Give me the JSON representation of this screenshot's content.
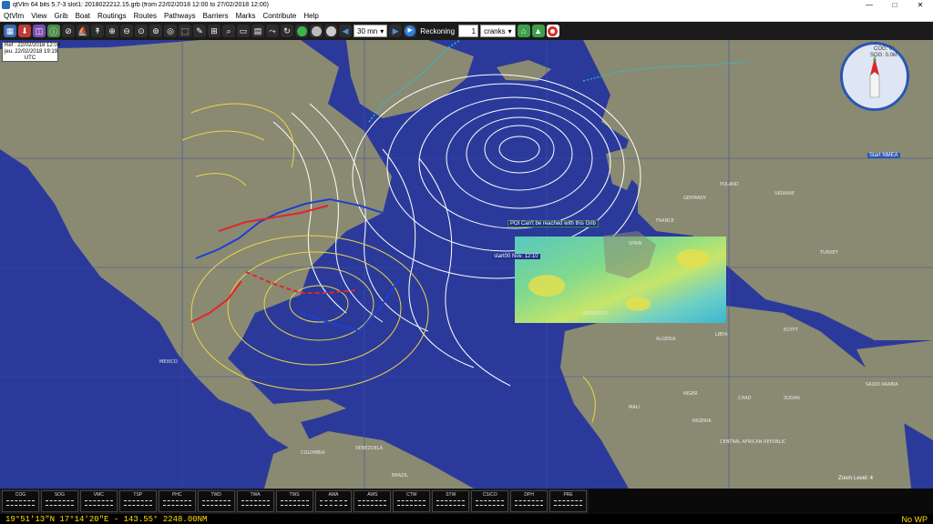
{
  "window": {
    "title": "qtVlm 64 bits 5.7-3 slot1: 2018022212.15.grb (from 22/02/2018 12:00 to 27/02/2018 12:00)",
    "minimize": "—",
    "maximize": "□",
    "close": "✕"
  },
  "menu": [
    "QtVlm",
    "View",
    "Grib",
    "Boat",
    "Routings",
    "Routes",
    "Pathways",
    "Barriers",
    "Marks",
    "Contribute",
    "Help"
  ],
  "toolbar": {
    "step": "30 mn",
    "mode": "Reckoning",
    "count": "1",
    "boat": "cranks"
  },
  "ref_box": {
    "ref": "Ref : 22/02/2018 12:00",
    "current": "jeu. 22/02/2018 19:19",
    "tz": "UTC"
  },
  "compass": {
    "cog": "COG: 0°",
    "sog": "SOG: 0.0kt",
    "start_nmea": "Start NMEA"
  },
  "map": {
    "grib_error": "POI Can't be reached with this Grib",
    "start_label": "start00 Nov. 12:10",
    "zoom": "Zoom Level: 4",
    "countries": [
      "MOROCCO",
      "ALGERIA",
      "LIBYA",
      "EGYPT",
      "MALI",
      "NIGER",
      "CHAD",
      "SUDAN",
      "NIGERIA",
      "CENTRAL AFRICAN REPUBLIC",
      "MEXICO",
      "VENEZUELA",
      "COLOMBIA",
      "BRAZIL",
      "SPAIN",
      "FRANCE",
      "GERMANY",
      "POLAND",
      "UKRAINE",
      "TURKEY",
      "SAUDI ARABIA"
    ]
  },
  "instruments": [
    "COG",
    "SOG",
    "VMC",
    "TSP",
    "PHC",
    "TWD",
    "TWA",
    "TWS",
    "AWA",
    "AWS",
    "CTW",
    "STW",
    "CS/CO",
    "DPH",
    "PRE"
  ],
  "status": {
    "position": "19°51'13\"N   17°14'20\"E - 143.55° 2248.00NM",
    "waypoint": "No WP"
  },
  "colors": {
    "ocean": "#2b3a9a",
    "land": "#8a8a72",
    "isobar": "#ffffff",
    "isobar_warm": "#e8d64a",
    "front_cold": "#1f3fd0",
    "front_warm": "#e0262a",
    "coastline_ice": "#20c4e0"
  }
}
